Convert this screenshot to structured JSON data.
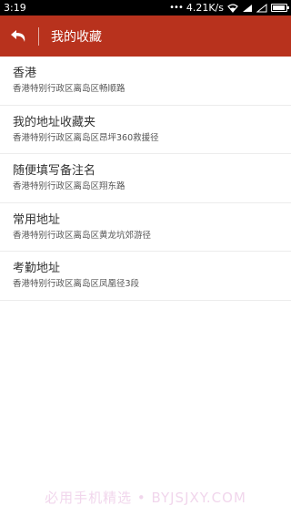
{
  "status_bar": {
    "time": "3:19",
    "dots": "•••",
    "speed": "4.21K/s"
  },
  "app_bar": {
    "title": "我的收藏",
    "back_icon": "back-arrow-icon",
    "color": "#b8321d"
  },
  "favorites": [
    {
      "name": "香港",
      "address": "香港特别行政区离岛区畅顺路"
    },
    {
      "name": "我的地址收藏夹",
      "address": "香港特别行政区离岛区昂坪360救援径"
    },
    {
      "name": "随便填写备注名",
      "address": "香港特别行政区离岛区翔东路"
    },
    {
      "name": "常用地址",
      "address": "香港特别行政区离岛区黄龙坑郊游径"
    },
    {
      "name": "考勤地址",
      "address": "香港特别行政区离岛区凤凰径3段"
    }
  ],
  "watermark": "必用手机精选 • BYJSJXY.COM"
}
